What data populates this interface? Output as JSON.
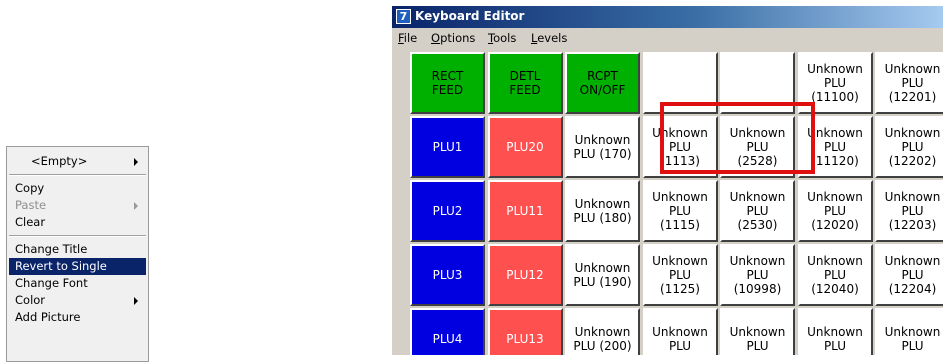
{
  "context_menu": {
    "items": [
      {
        "label": "<Empty>",
        "state": "normal",
        "submenu": true
      },
      {
        "separator": true
      },
      {
        "label": "Copy",
        "state": "normal"
      },
      {
        "label": "Paste",
        "state": "disabled",
        "submenu": true
      },
      {
        "label": "Clear",
        "state": "normal"
      },
      {
        "separator": true
      },
      {
        "label": "Change Title",
        "state": "normal"
      },
      {
        "label": "Revert to Single",
        "state": "selected"
      },
      {
        "label": "Change Font",
        "state": "normal"
      },
      {
        "label": "Color",
        "state": "normal",
        "submenu": true
      },
      {
        "label": "Add Picture",
        "state": "normal"
      }
    ]
  },
  "window": {
    "title": "Keyboard Editor",
    "icon_glyph": "7",
    "menu": [
      "File",
      "Options",
      "Tools",
      "Levels"
    ],
    "highlight_color": "#e01010"
  },
  "colors": {
    "green": "#00b000",
    "blue": "#0000e0",
    "red": "#ff5050",
    "white": "#ffffff"
  },
  "keys": [
    [
      {
        "label": "RECT\nFEED",
        "color": "green",
        "text_color": "#000000"
      },
      {
        "label": "DETL\nFEED",
        "color": "green",
        "text_color": "#000000"
      },
      {
        "label": "RCPT\nON/OFF",
        "color": "green",
        "text_color": "#000000"
      },
      {
        "label": "",
        "color": "white",
        "text_color": "#000000"
      },
      {
        "label": "",
        "color": "white",
        "text_color": "#000000"
      },
      {
        "label": "Unknown\nPLU\n(11100)",
        "color": "white",
        "text_color": "#000000"
      },
      {
        "label": "Unknown\nPLU\n(12201)",
        "color": "white",
        "text_color": "#000000"
      }
    ],
    [
      {
        "label": "PLU1",
        "color": "blue",
        "text_color": "#ffffff"
      },
      {
        "label": "PLU20",
        "color": "red",
        "text_color": "#ffffff"
      },
      {
        "label": "Unknown\nPLU (170)",
        "color": "white",
        "text_color": "#000000"
      },
      {
        "label": "Unknown\nPLU\n(1113)",
        "color": "white",
        "text_color": "#000000"
      },
      {
        "label": "Unknown\nPLU\n(2528)",
        "color": "white",
        "text_color": "#000000"
      },
      {
        "label": "Unknown\nPLU\n(11120)",
        "color": "white",
        "text_color": "#000000"
      },
      {
        "label": "Unknown\nPLU\n(12202)",
        "color": "white",
        "text_color": "#000000"
      }
    ],
    [
      {
        "label": "PLU2",
        "color": "blue",
        "text_color": "#ffffff"
      },
      {
        "label": "PLU11",
        "color": "red",
        "text_color": "#ffffff"
      },
      {
        "label": "Unknown\nPLU (180)",
        "color": "white",
        "text_color": "#000000"
      },
      {
        "label": "Unknown\nPLU\n(1115)",
        "color": "white",
        "text_color": "#000000"
      },
      {
        "label": "Unknown\nPLU\n(2530)",
        "color": "white",
        "text_color": "#000000"
      },
      {
        "label": "Unknown\nPLU\n(12020)",
        "color": "white",
        "text_color": "#000000"
      },
      {
        "label": "Unknown\nPLU\n(12203)",
        "color": "white",
        "text_color": "#000000"
      }
    ],
    [
      {
        "label": "PLU3",
        "color": "blue",
        "text_color": "#ffffff"
      },
      {
        "label": "PLU12",
        "color": "red",
        "text_color": "#ffffff"
      },
      {
        "label": "Unknown\nPLU (190)",
        "color": "white",
        "text_color": "#000000"
      },
      {
        "label": "Unknown\nPLU\n(1125)",
        "color": "white",
        "text_color": "#000000"
      },
      {
        "label": "Unknown\nPLU\n(10998)",
        "color": "white",
        "text_color": "#000000"
      },
      {
        "label": "Unknown\nPLU\n(12040)",
        "color": "white",
        "text_color": "#000000"
      },
      {
        "label": "Unknown\nPLU\n(12204)",
        "color": "white",
        "text_color": "#000000"
      }
    ],
    [
      {
        "label": "PLU4",
        "color": "blue",
        "text_color": "#ffffff"
      },
      {
        "label": "PLU13",
        "color": "red",
        "text_color": "#ffffff"
      },
      {
        "label": "Unknown\nPLU (200)",
        "color": "white",
        "text_color": "#000000"
      },
      {
        "label": "Unknown\nPLU",
        "color": "white",
        "text_color": "#000000"
      },
      {
        "label": "Unknown\nPLU",
        "color": "white",
        "text_color": "#000000"
      },
      {
        "label": "Unknown\nPLU",
        "color": "white",
        "text_color": "#000000"
      },
      {
        "label": "Unknown\nPLU",
        "color": "white",
        "text_color": "#000000"
      }
    ]
  ]
}
